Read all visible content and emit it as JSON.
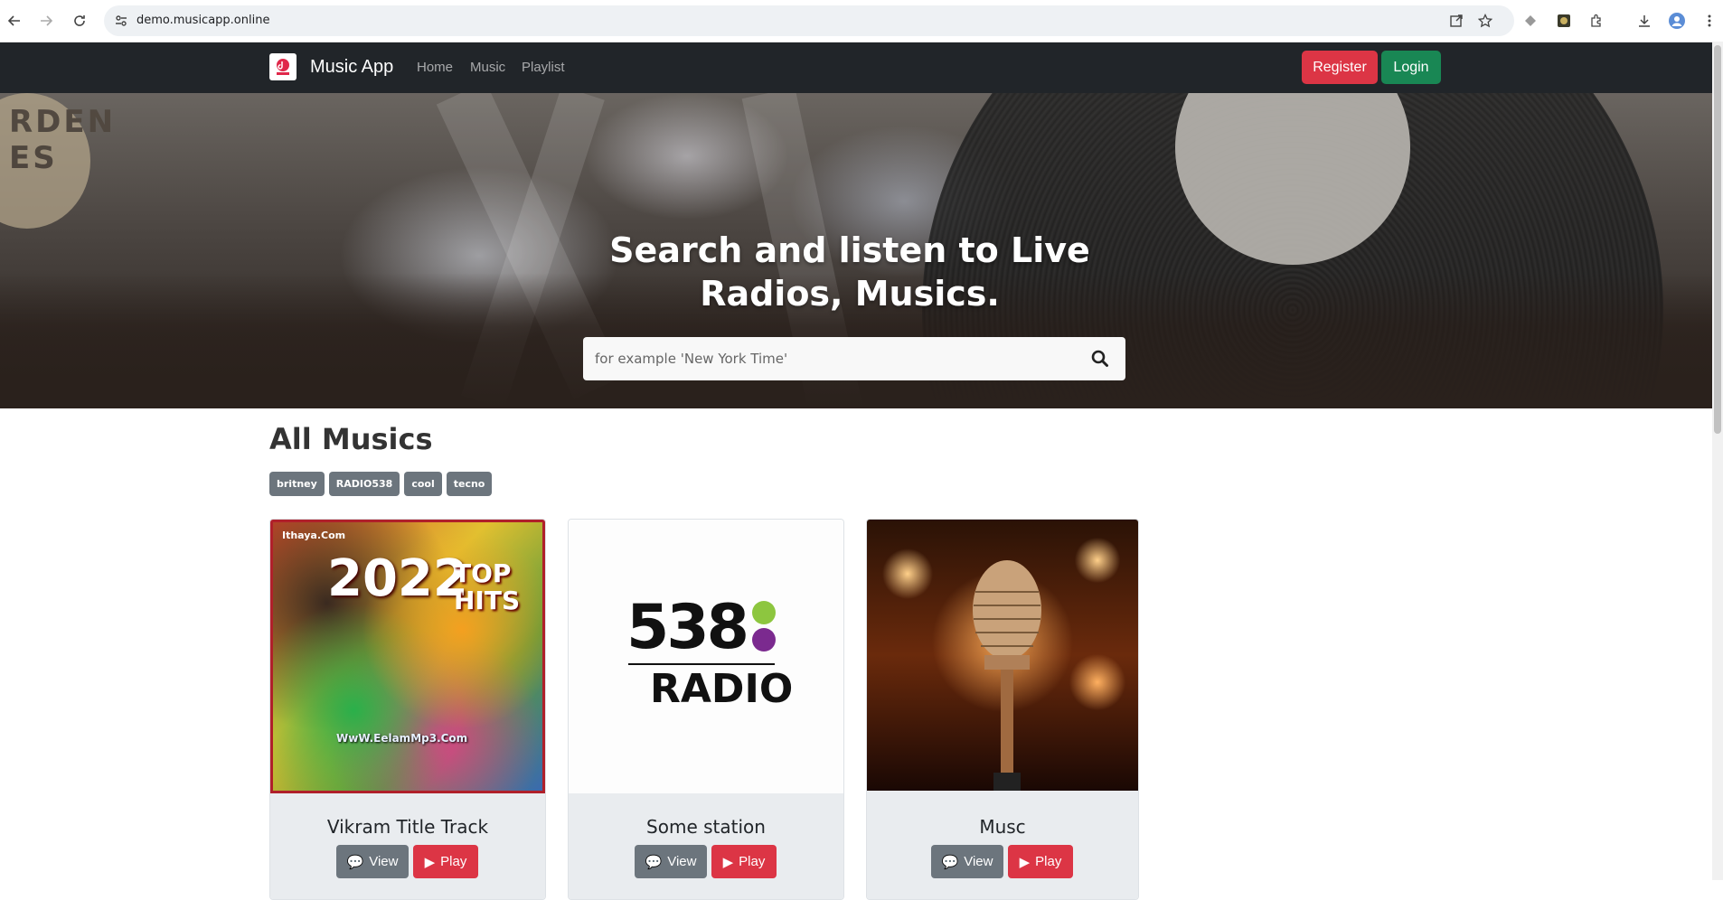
{
  "browser": {
    "url": "demo.musicapp.online"
  },
  "navbar": {
    "brand": "Music App",
    "links": [
      "Home",
      "Music",
      "Playlist"
    ],
    "register_label": "Register",
    "login_label": "Login"
  },
  "hero": {
    "title_line1_pre": "Search and listen to ",
    "title_line1_bold": "Live",
    "title_line2": "Radios, Musics.",
    "search_placeholder": "for example 'New York Time'"
  },
  "main": {
    "section_title": "All Musics",
    "tags": [
      "britney",
      "RADIO538",
      "cool",
      "tecno"
    ],
    "cards": [
      {
        "title": "Vikram Title Track",
        "view_label": "View",
        "play_label": "Play",
        "image_text_top": "Ithaya.Com",
        "image_text_year": "2022",
        "image_text_hits": "TOP HITS",
        "image_text_bottom": "WwW.EelamMp3.Com"
      },
      {
        "title": "Some station",
        "view_label": "View",
        "play_label": "Play",
        "image_text_num": "538",
        "image_text_radio": "RADIO"
      },
      {
        "title": "Musc",
        "view_label": "View",
        "play_label": "Play"
      }
    ]
  },
  "hero_sign": "RDEN ES",
  "colors": {
    "navbar_bg": "#212529",
    "register": "#dc3545",
    "login": "#198754",
    "tag": "#6c757d",
    "play": "#dc3545",
    "view": "#6c757d"
  }
}
